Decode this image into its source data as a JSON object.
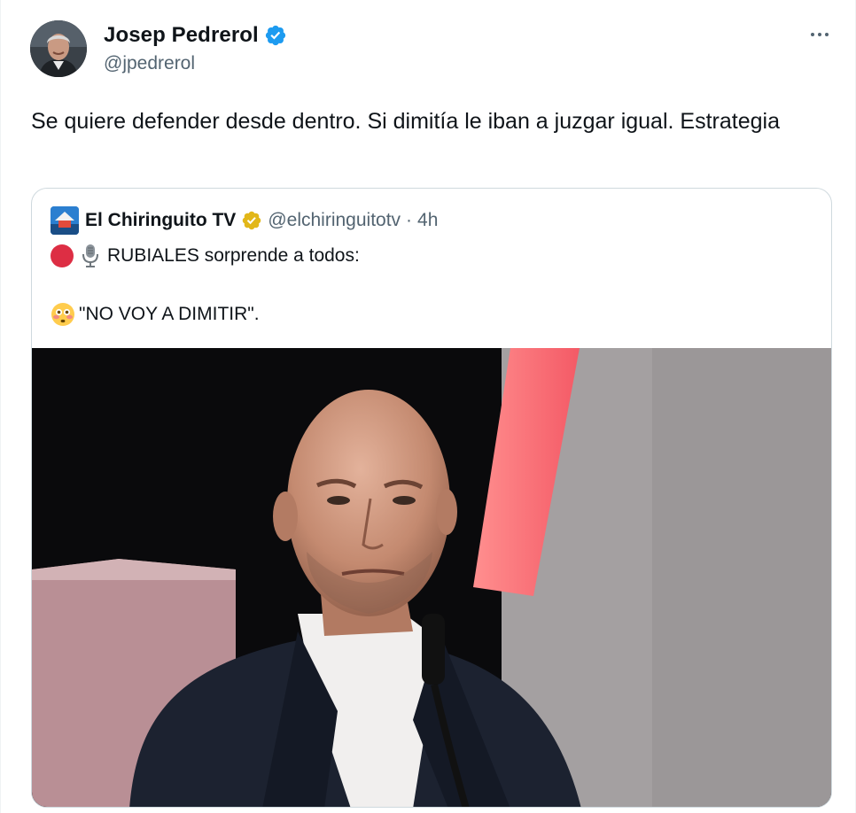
{
  "tweet": {
    "author": {
      "name": "Josep Pedrerol",
      "handle": "@jpedrerol",
      "verified_icon": "verified-badge-icon",
      "avatar": "profile-photo"
    },
    "more_icon": "more-options-icon",
    "text": "Se quiere defender desde dentro. Si dimitía le iban a juzgar igual. Estrategia"
  },
  "quoted": {
    "author": {
      "name": "El Chiringuito TV",
      "handle": "@elchiringuitotv",
      "separator": "·",
      "time": "4h",
      "badge_icon": "gold-verified-badge-icon"
    },
    "line1_text": "RUBIALES sorprende a todos:",
    "line1_icons": [
      "red-circle-icon",
      "microphone-icon"
    ],
    "line2_text": "\"NO VOY A DIMITIR\".",
    "line2_icon": "flushed-face-icon",
    "media": "video-still-man-at-podium"
  },
  "colors": {
    "text_primary": "#0f1419",
    "text_secondary": "#536471",
    "border": "#cfd9de",
    "verified_blue": "#1d9bf0",
    "gold_badge": "#e2b719",
    "red_dot": "#dd2e44"
  }
}
